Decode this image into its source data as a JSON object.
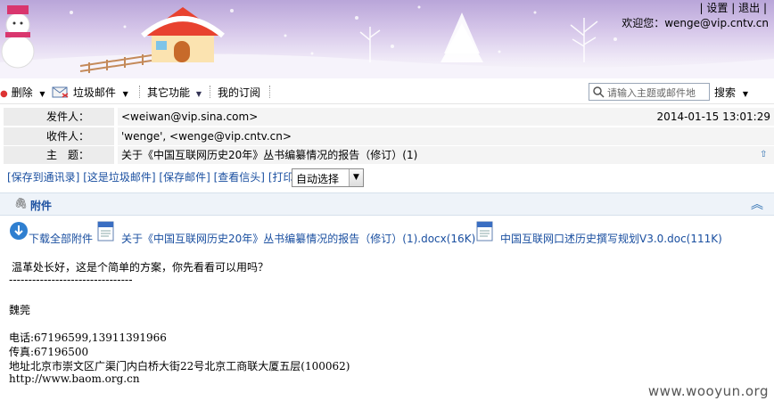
{
  "top_links": {
    "left": "|",
    "settings": "设置",
    "sep": "|",
    "logout": "退出",
    "tail": "|"
  },
  "welcome": "欢迎您：wenge@vip.cntv.cn",
  "toolbar": {
    "delete": "删除",
    "spam": "垃圾邮件",
    "other": "其它功能",
    "subscriptions": "我的订阅",
    "search_placeholder": "请输入主题或邮件地",
    "search_button": "搜索"
  },
  "header": {
    "from_label": "发件人：",
    "from_value": "<weiwan@vip.sina.com>",
    "date": "2014-01-15 13:01:29",
    "to_label": "收件人：",
    "to_value": "'wenge',  <wenge@vip.cntv.cn>",
    "subject_label": "主　题：",
    "subject_value": "关于《中国互联网历史20年》丛书编纂情况的报告（修订）(1)"
  },
  "actions": [
    "[保存到通讯录]",
    "[这是垃圾邮件]",
    "[保存邮件]",
    "[查看信头]",
    "[打印]"
  ],
  "encoding_select": "自动选择",
  "attachments": {
    "title": "附件",
    "download_all": "下载全部附件",
    "files": [
      "关于《中国互联网历史20年》丛书编纂情况的报告（修订）(1).docx(16K)",
      "中国互联网口述历史撰写规划V3.0.doc(111K)"
    ]
  },
  "body": {
    "greeting": "温革处长好，这是个简单的方案，你先看看可以用吗？",
    "divider": "--------------------------------",
    "name": "魏莞",
    "phone": "电话:67196599,13911391966",
    "fax": "传真:67196500",
    "address": "地址北京市崇文区广渠门内白桥大街22号北京工商联大厦五层(100062)",
    "website": "http://www.baom.org.cn"
  },
  "watermark": "www.wooyun.org"
}
